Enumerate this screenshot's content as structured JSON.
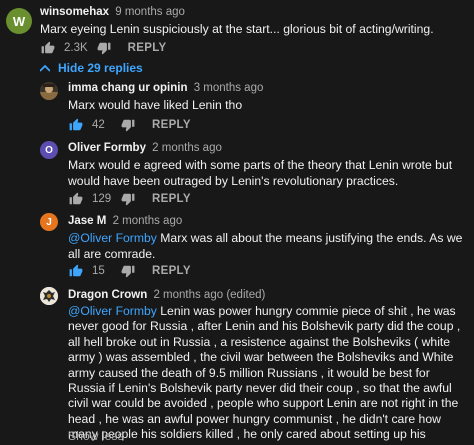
{
  "top_comment": {
    "avatar_letter": "W",
    "avatar_color": "#6a8f2f",
    "author": "winsomehax",
    "time": "9 months ago",
    "text": "Marx eyeing Lenin suspiciously at the start... glorious bit of acting/writing.",
    "likes": "2.3K",
    "reply_label": "REPLY"
  },
  "hide_replies": {
    "label": "Hide 29 replies",
    "icon": "chevron-up-icon",
    "color": "#3ea6ff"
  },
  "replies": [
    {
      "author": "imma chang ur opinin",
      "time": "3 months ago",
      "avatar_icon": "photo-avatar",
      "text": "Marx would have liked Lenin tho",
      "likes": "42",
      "reply_label": "REPLY"
    },
    {
      "author": "Oliver Formby",
      "time": "2 months ago",
      "avatar_letter": "O",
      "avatar_color": "#5c4db1",
      "text": "Marx would e agreed with some parts of the theory that Lenin wrote but would have been outraged by Lenin's revolutionary practices.",
      "likes": "129",
      "reply_label": "REPLY"
    },
    {
      "author": "Jase M",
      "time": "2 months ago",
      "avatar_letter": "J",
      "avatar_color": "#e6751f",
      "mention": "@Oliver Formby",
      "text": " Marx was all about the means justifying the ends. As we all are comrade.",
      "likes": "15",
      "reply_label": "REPLY"
    },
    {
      "author": "Dragon Crown",
      "time": "2 months ago (edited)",
      "avatar_icon": "crest-avatar",
      "mention": "@Oliver Formby",
      "text": " Lenin was power hungry commie piece of shit , he was never good for Russia , after Lenin and his Bolshevik party did the coup , all hell broke out in Russia , a resistence against the Bolsheviks ( white army ) was assembled , the civil war between the Bolsheviks and White army caused the death of 9.5 million Russians , it would be best for Russia if Lenin's Bolshevik party never did their coup , so that the awful civil war could be avoided , people who support Lenin are not right in the head , he was an awful power hungry communist , he didn't care how many people his soldiers killed , he only cared about setting up his autoritharian communist state with himself as the dictator",
      "show_less": "Show less"
    }
  ],
  "icons": {
    "like": "thumbs-up-icon",
    "dislike": "thumbs-down-icon"
  },
  "colors": {
    "background": "#181818",
    "text": "#f1f1f1",
    "secondary": "#aaaaaa",
    "link": "#3ea6ff",
    "like_icon_active": "#3ea6ff"
  }
}
